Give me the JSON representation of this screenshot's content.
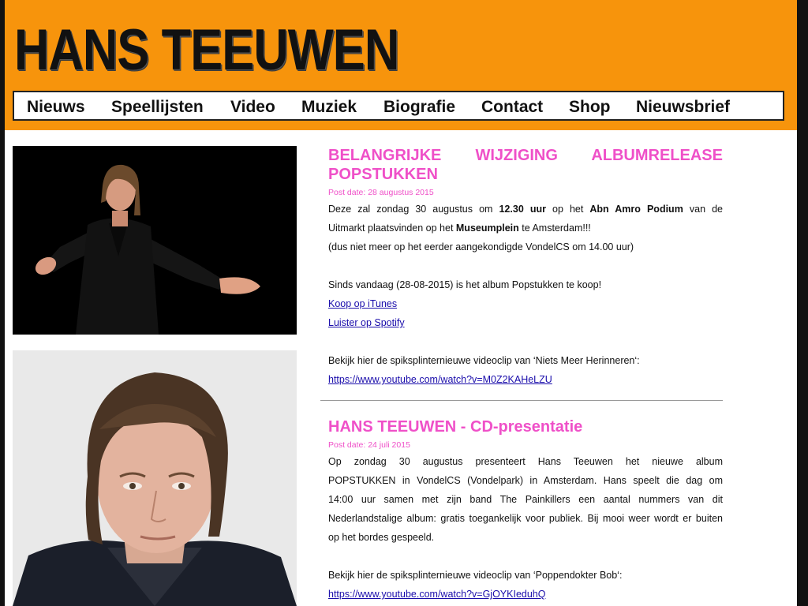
{
  "site": {
    "title": "HANS TEEUWEN"
  },
  "nav": [
    "Nieuws",
    "Speellijsten",
    "Video",
    "Muziek",
    "Biografie",
    "Contact",
    "Shop",
    "Nieuwsbrief"
  ],
  "colors": {
    "header_bg": "#f7940c",
    "accent_pink": "#ef50c8",
    "link": "#1a0dab"
  },
  "post1": {
    "title_line1": "BELANGRIJKE WIJZIGING ALBUMRELEASE",
    "title_line2": "POPSTUKKEN",
    "date": "Post date: 28 augustus 2015",
    "p1_a": "Deze zal zondag 30 augustus om ",
    "p1_b": "12.30 uur",
    "p1_c": " op het ",
    "p1_d": "Abn Amro Podium",
    "p1_e": " van de",
    "p2_a": "Uitmarkt plaatsvinden op het ",
    "p2_b": "Museumplein",
    "p2_c": " te Amsterdam!!!",
    "p3": "(dus niet meer op het eerder aangekondigde VondelCS om 14.00 uur)",
    "p4": "Sinds vandaag (28-08-2015) is het album Popstukken te koop!",
    "link_itunes": "Koop op iTunes",
    "link_spotify": "Luister op Spotify",
    "p5": "Bekijk hier de spiksplinternieuwe videoclip van ‘Niets Meer Herinneren‘:",
    "link_youtube": "https://www.youtube.com/watch?v=M0Z2KAHeLZU"
  },
  "post2": {
    "title": "HANS TEEUWEN - CD-presentatie",
    "date": "Post date: 24 juli 2015",
    "lines": [
      "Op zondag 30 augustus presenteert Hans Teeuwen het nieuwe album",
      "POPSTUKKEN in VondelCS (Vondelpark) in Amsterdam. Hans speelt die dag om",
      "14:00 uur samen met zijn band The Painkillers een aantal nummers van dit",
      "Nederlandstalige album: gratis toegankelijk voor publiek. Bij mooi weer wordt er buiten"
    ],
    "last_line": "op het bordes gespeeld.",
    "p2": "Bekijk hier de spiksplinternieuwe videoclip van ‘Poppendokter Bob‘:",
    "link_youtube": "https://www.youtube.com/watch?v=GjOYKIeduhQ"
  }
}
